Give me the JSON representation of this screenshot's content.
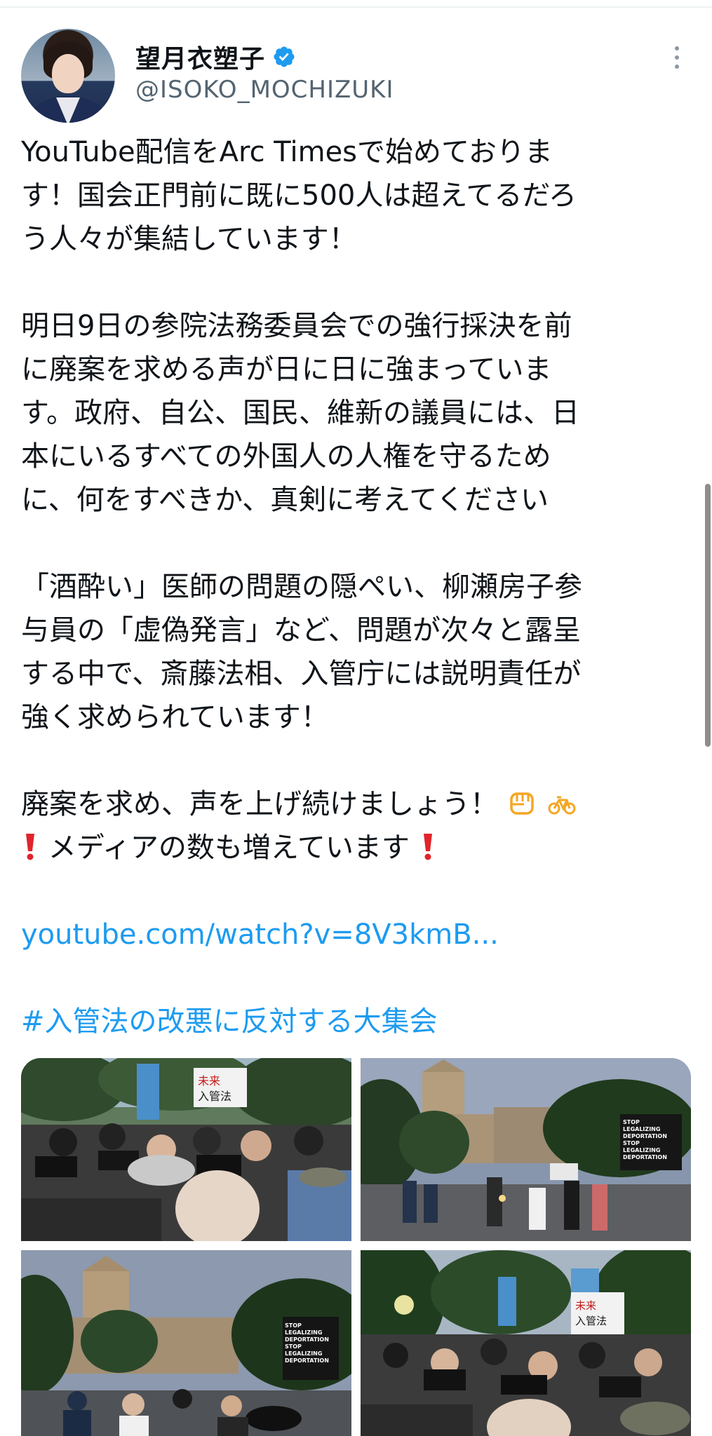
{
  "author": {
    "display_name": "望月衣塑子",
    "handle": "@ISOKO_MOCHIZUKI",
    "verified": true,
    "verified_color": "#1d9bf0"
  },
  "tweet": {
    "paragraph1": [
      "YouTube配信をArc Timesで始めておりま",
      "す！国会正門前に既に500人は超えてるだろ",
      "う人々が集結しています！"
    ],
    "paragraph2": [
      "明日9日の参院法務委員会での強行採決を前",
      "に廃案を求める声が日に日に強まっていま",
      "す。政府、自公、国民、維新の議員には、日",
      "本にいるすべての外国人の人権を守るため",
      "に、何をすべきか、真剣に考えてください"
    ],
    "paragraph3": [
      "「酒酔い」医師の問題の隠ぺい、柳瀬房子参",
      "与員の「虚偽発言」など、問題が次々と露呈",
      "する中で、斎藤法相、入管庁には説明責任が",
      "強く求められています！"
    ],
    "paragraph4_line1": "廃案を求め、声を上げ続けましょう！",
    "paragraph4_line2": "メディアの数も増えています",
    "link": "youtube.com/watch?v=8V3kmB...",
    "hashtag": "#入管法の改悪に反対する大集会"
  },
  "icons": {
    "fist": "raised-fist-icon",
    "bicycle": "bicycle-icon",
    "exclamation": "red-exclamation-icon",
    "more": "more-options-icon"
  },
  "colors": {
    "link": "#1d9bf0",
    "handle": "#536471",
    "emoji_orange": "#f5a623",
    "exclamation_red": "#e0242b"
  },
  "media": {
    "photos": [
      {
        "alt": "Crowd of camera operators at a protest with banners"
      },
      {
        "alt": "National Diet building at dusk with protest signs"
      },
      {
        "alt": "Diet building at dusk with STOP LEGALIZING DEPORTATION sign"
      },
      {
        "alt": "Crowd with banners and media cameras in front of trees"
      }
    ],
    "sign_text": [
      "STOP",
      "LEGALIZING",
      "DEPORTATION",
      "STOP",
      "LEGALIZING",
      "DEPORTATION",
      "STOP",
      "LEGALIZING",
      "DEPORTATION"
    ]
  }
}
